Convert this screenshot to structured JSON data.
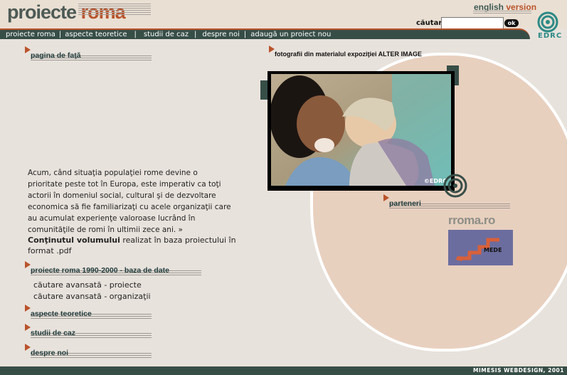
{
  "header": {
    "logo_word1": "proiecte",
    "logo_word2": "roma",
    "english_word1": "english",
    "english_word2": "version",
    "search_label": "căutare",
    "search_value": "",
    "search_button": "ok"
  },
  "nav": {
    "items": [
      "proiecte roma",
      "aspecte teoretice",
      "studii de caz",
      "despre noi",
      "adaugă un proiect nou"
    ],
    "separator": "|"
  },
  "brand": {
    "org": "EDRC",
    "accent_color": "#b9532b",
    "dark_color": "#374e47",
    "teal_color": "#2c8a86"
  },
  "left": {
    "home_title": "pagina de faţă",
    "intro": "Acum, când situaţia populaţiei rome devine o prioritate peste tot în Europa, este imperativ ca toţi actorii în domeniul social, cultural şi de dezvoltare economica să fie familiarizaţi cu acele organizaţii care au acumulat experienţe valoroase lucrând în comunităţile de romi în ultimii zece ani. »",
    "volume_bold": "Conţinutul volumului",
    "volume_rest": " realizat în baza proiectului în format .pdf",
    "db_title": "proiecte roma 1990-2000 - baza de date",
    "search_projects": "căutare avansată - proiecte",
    "search_orgs": "căutare avansată - organizaţii",
    "theory_title": "aspecte teoretice",
    "cases_title": "studii de caz",
    "about_title": "despre noi"
  },
  "right": {
    "photo_caption": "fotografii din materialul expoziţiei ALTER IMAGE",
    "photo_credit": "©EDRC",
    "partners_title": "parteneri",
    "partner1": "rroma.ro",
    "partner2": "MEDE"
  },
  "footer": {
    "credit": "MIMESIS WEBDESIGN, 2001"
  }
}
